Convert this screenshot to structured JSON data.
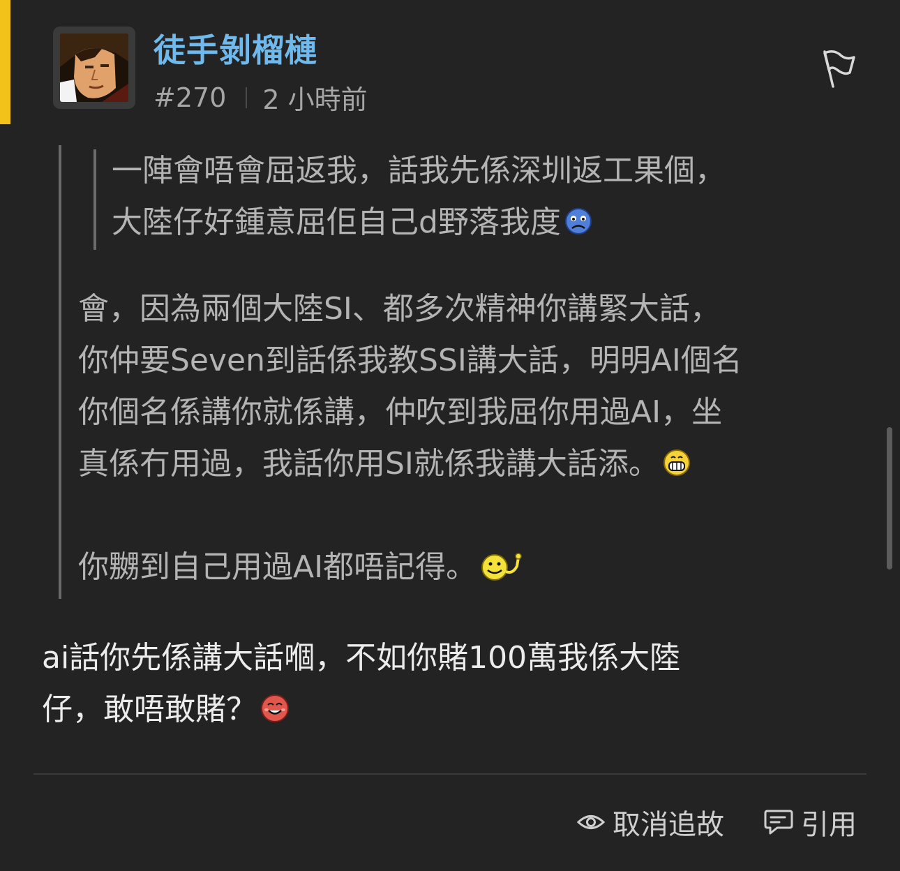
{
  "post": {
    "username": "徒手剝榴槤",
    "number": "#270",
    "time": "2 小時前"
  },
  "quote": {
    "inner_lines": [
      "一陣會唔會屈返我，話我先係深圳返工果個，",
      "大陸仔好鍾意屈佢自己d野落我度"
    ],
    "outer_lines": [
      "會，因為兩個大陸SI、都多次精神你講緊大話，",
      "你仲要Seven到話係我教SSI講大話，明明AI個名",
      "你個名係講你就係講，仲吹到我屈你用過AI，坐",
      "真係冇用過，我話你用SI就係我講大話添。",
      "",
      "你嬲到自己用過AI都唔記得。"
    ]
  },
  "reply": {
    "lines": [
      "ai話你先係講大話嗰，不如你賭100萬我係大陸",
      "仔，敢唔敢賭？"
    ]
  },
  "actions": {
    "unfollow_label": "取消追故",
    "quote_label": "引用"
  },
  "colors": {
    "accent": "#f2c21a",
    "username": "#6fb9ec",
    "background": "#232323"
  },
  "icons": {
    "report": "flag-icon",
    "unfollow": "eye-icon",
    "quote": "quote-bubble-icon",
    "emoji_sad": "sad-face-icon",
    "emoji_grin": "grin-face-icon",
    "emoji_wink": "smiley-tongue-icon",
    "emoji_blush": "blush-face-icon"
  }
}
